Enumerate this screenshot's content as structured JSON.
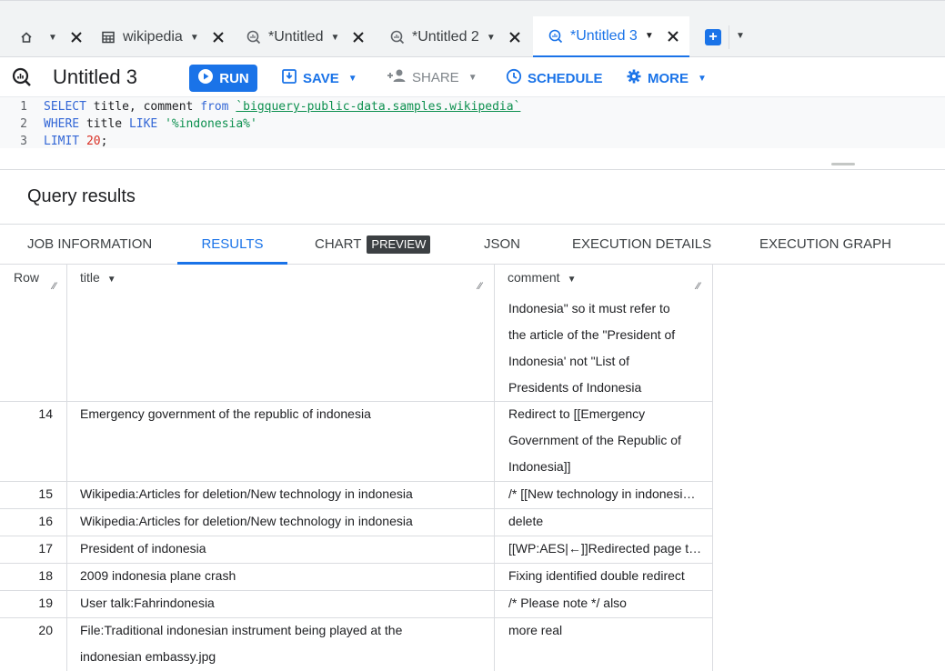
{
  "tabs": [
    {
      "label": "",
      "icon": "home-icon"
    },
    {
      "label": "wikipedia",
      "icon": "table-icon"
    },
    {
      "label": "*Untitled",
      "icon": "query-icon"
    },
    {
      "label": "*Untitled 2",
      "icon": "query-icon"
    },
    {
      "label": "*Untitled 3",
      "icon": "query-icon",
      "active": true
    }
  ],
  "toolbar": {
    "title": "Untitled 3",
    "run_label": "RUN",
    "save_label": "SAVE",
    "share_label": "SHARE",
    "schedule_label": "SCHEDULE",
    "more_label": "MORE"
  },
  "editor": {
    "lines": [
      {
        "num": "1",
        "kw1": "SELECT",
        "t1": " title, comment ",
        "kw2": "from",
        "t2": " ",
        "str": "`bigquery-public-data.samples.wikipedia`"
      },
      {
        "num": "2",
        "kw1": "WHERE",
        "t1": " title ",
        "kw2": "LIKE",
        "t2": " ",
        "str": "'%indonesia%'"
      },
      {
        "num": "3",
        "kw1": "LIMIT",
        "t1": " ",
        "numval": "20",
        "t2": ";"
      }
    ]
  },
  "results": {
    "heading": "Query results",
    "tabs": {
      "job_info": "JOB INFORMATION",
      "results": "RESULTS",
      "chart": "CHART",
      "chart_badge": "PREVIEW",
      "json": "JSON",
      "exec_details": "EXECUTION DETAILS",
      "exec_graph": "EXECUTION GRAPH"
    },
    "columns": {
      "row": "Row",
      "title": "title",
      "comment": "comment"
    },
    "partial_comment": [
      "Indonesia\" so it must refer to",
      "the article of the \"President of",
      "Indonesia' not \"List of",
      "Presidents of Indonesia"
    ],
    "rows": [
      {
        "row": "14",
        "title": [
          "Emergency government of the republic of indonesia"
        ],
        "comment": [
          "Redirect to [[Emergency",
          "Government of the Republic of",
          "Indonesia]]"
        ]
      },
      {
        "row": "15",
        "title": [
          "Wikipedia:Articles for deletion/New technology in indonesia"
        ],
        "comment": [
          "/* [[New technology in indonesi…"
        ]
      },
      {
        "row": "16",
        "title": [
          "Wikipedia:Articles for deletion/New technology in indonesia"
        ],
        "comment": [
          "delete"
        ]
      },
      {
        "row": "17",
        "title": [
          "President of indonesia"
        ],
        "comment": [
          "[[WP:AES|←]]Redirected page t…"
        ]
      },
      {
        "row": "18",
        "title": [
          "2009 indonesia plane crash"
        ],
        "comment": [
          "Fixing identified double redirect"
        ]
      },
      {
        "row": "19",
        "title": [
          "User talk:Fahrindonesia"
        ],
        "comment": [
          "/* Please note */ also"
        ]
      },
      {
        "row": "20",
        "title": [
          "File:Traditional indonesian instrument being played at the",
          "indonesian embassy.jpg"
        ],
        "comment": [
          "more real"
        ]
      }
    ]
  }
}
